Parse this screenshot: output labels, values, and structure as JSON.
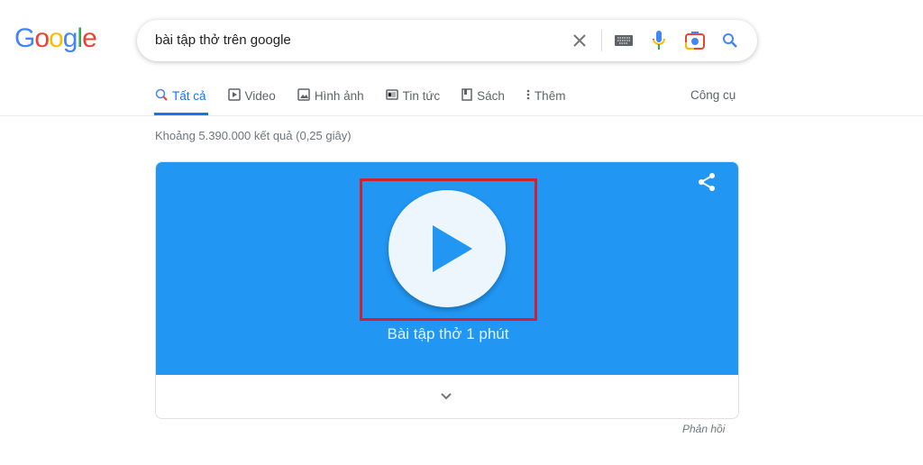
{
  "logo": "Google",
  "search": {
    "query": "bài tập thở trên google"
  },
  "tabs": [
    {
      "label": "Tất cả",
      "icon": "search-icon",
      "active": true
    },
    {
      "label": "Video",
      "icon": "video-icon"
    },
    {
      "label": "Hình ảnh",
      "icon": "image-icon"
    },
    {
      "label": "Tin tức",
      "icon": "news-icon"
    },
    {
      "label": "Sách",
      "icon": "book-icon"
    },
    {
      "label": "Thêm",
      "icon": "more-icon"
    }
  ],
  "tools": "Công cụ",
  "stats": "Khoảng 5.390.000 kết quả (0,25 giây)",
  "card": {
    "title": "Bài tập thở 1 phút",
    "accent": "#2196f3",
    "highlight": "#d0212f"
  },
  "feedback": "Phản hồi"
}
